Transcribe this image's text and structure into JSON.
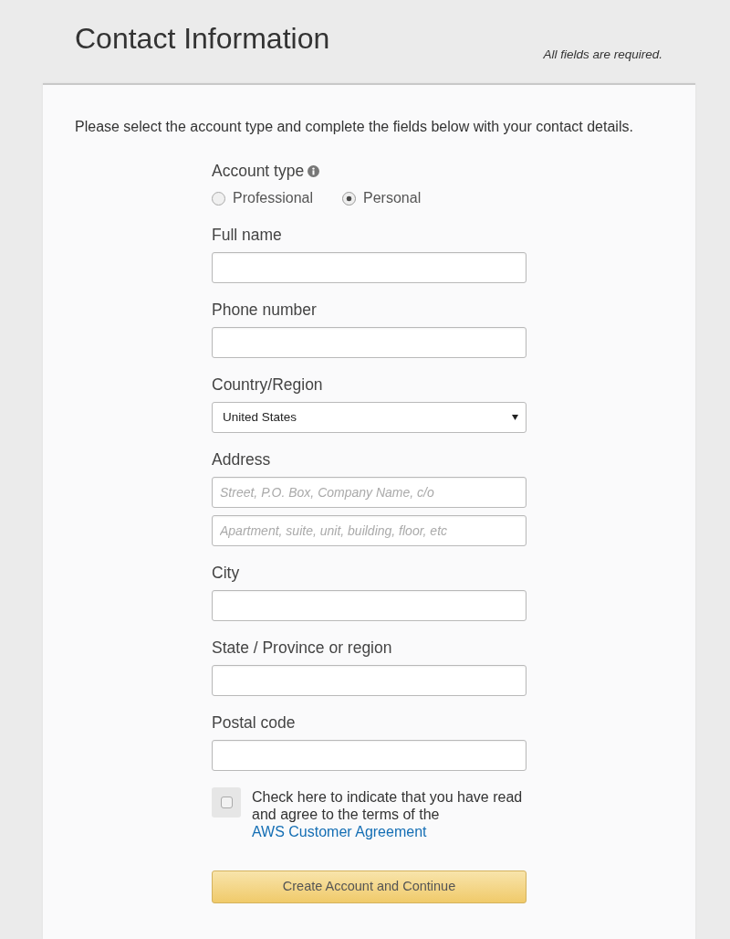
{
  "header": {
    "title": "Contact Information",
    "note": "All fields are required."
  },
  "intro": "Please select the account type and complete the fields below with your contact details.",
  "account_type": {
    "label": "Account type",
    "options": [
      {
        "label": "Professional",
        "selected": false
      },
      {
        "label": "Personal",
        "selected": true
      }
    ]
  },
  "fields": [
    {
      "label": "Full name",
      "inputs": [
        {
          "kind": "text"
        }
      ]
    },
    {
      "label": "Phone number",
      "inputs": [
        {
          "kind": "text"
        }
      ]
    },
    {
      "label": "Country/Region",
      "inputs": [
        {
          "kind": "select",
          "value": "United States"
        }
      ]
    },
    {
      "label": "Address",
      "inputs": [
        {
          "kind": "text",
          "placeholder": "Street, P.O. Box, Company Name, c/o"
        },
        {
          "kind": "text",
          "placeholder": "Apartment, suite, unit, building, floor, etc"
        }
      ]
    },
    {
      "label": "City",
      "inputs": [
        {
          "kind": "text"
        }
      ]
    },
    {
      "label": "State / Province or region",
      "inputs": [
        {
          "kind": "text"
        }
      ]
    },
    {
      "label": "Postal code",
      "inputs": [
        {
          "kind": "text"
        }
      ]
    }
  ],
  "agreement": {
    "checked": false,
    "text": "Check here to indicate that you have read and agree to the terms of the",
    "link": "AWS Customer Agreement"
  },
  "submit": {
    "label": "Create Account and Continue"
  }
}
